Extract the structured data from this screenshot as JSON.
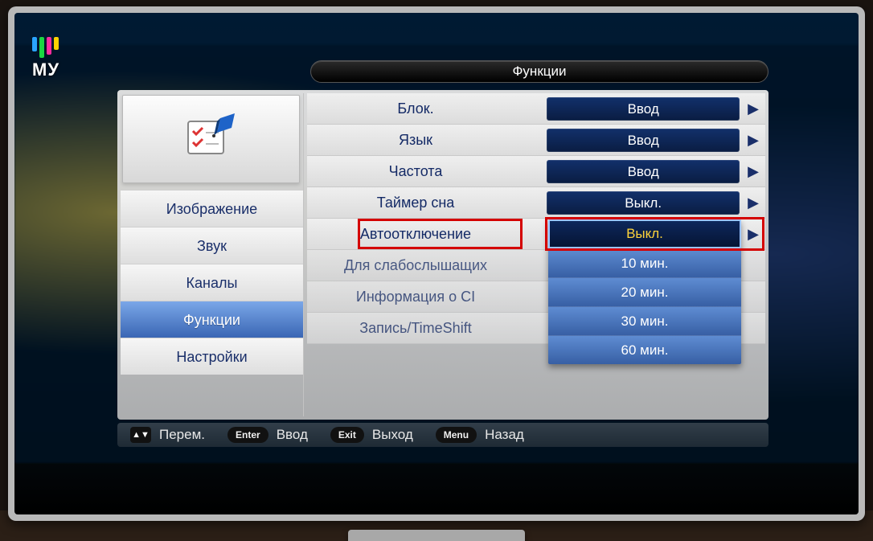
{
  "channel_logo_text": "МУ",
  "menu_title": "Функции",
  "sidebar": {
    "items": [
      {
        "label": "Изображение"
      },
      {
        "label": "Звук"
      },
      {
        "label": "Каналы"
      },
      {
        "label": "Функции",
        "active": true
      },
      {
        "label": "Настройки"
      }
    ]
  },
  "settings": [
    {
      "label": "Блок.",
      "value": "Ввод"
    },
    {
      "label": "Язык",
      "value": "Ввод"
    },
    {
      "label": "Частота",
      "value": "Ввод"
    },
    {
      "label": "Таймер сна",
      "value": "Выкл."
    },
    {
      "label": "Автоотключение",
      "value": "Выкл.",
      "highlighted": true
    },
    {
      "label": "Для слабослышащих",
      "value": ""
    },
    {
      "label": "Информация о CI",
      "value": ""
    },
    {
      "label": "Запись/TimeShift",
      "value": ""
    }
  ],
  "dropdown": {
    "selected": "Выкл.",
    "options": [
      "Выкл.",
      "10 мин.",
      "20 мин.",
      "30 мин.",
      "60 мин."
    ]
  },
  "legend": {
    "move": "Перем.",
    "enter_key": "Enter",
    "enter_label": "Ввод",
    "exit_key": "Exit",
    "exit_label": "Выход",
    "menu_key": "Menu",
    "menu_label": "Назад"
  }
}
